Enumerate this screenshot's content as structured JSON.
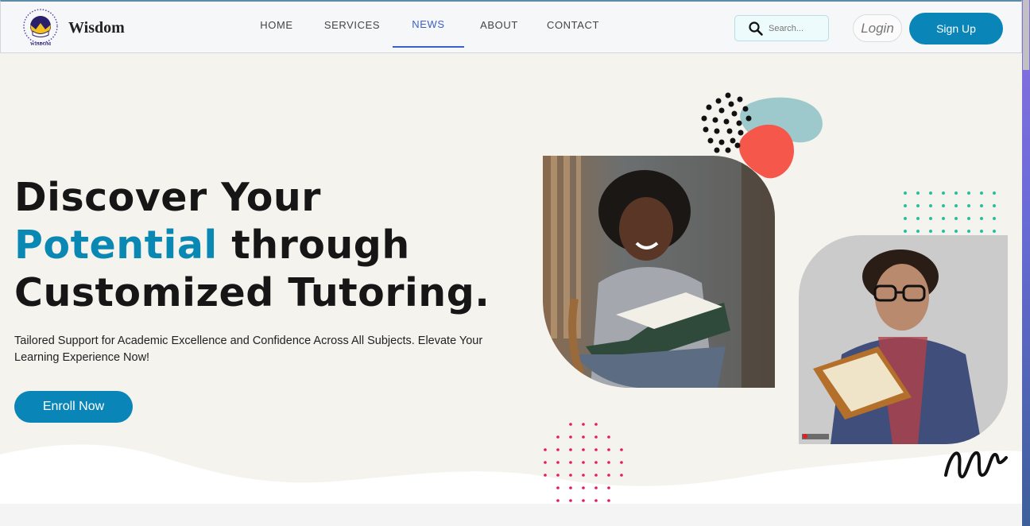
{
  "brand": {
    "name": "Wisdom",
    "logo_text": "WISDOM"
  },
  "nav": {
    "items": [
      {
        "label": "HOME",
        "active": false
      },
      {
        "label": "SERVICES",
        "active": false
      },
      {
        "label": "NEWS",
        "active": true
      },
      {
        "label": "ABOUT",
        "active": false
      },
      {
        "label": "CONTACT",
        "active": false
      }
    ]
  },
  "search": {
    "placeholder": "Search...",
    "icon": "search-icon"
  },
  "auth": {
    "login_label": "Login",
    "signup_label": "Sign Up"
  },
  "hero": {
    "headline_line1": "Discover Your",
    "headline_accent": "Potential",
    "headline_line2_rest": "through",
    "headline_line3": "Customized Tutoring.",
    "subtext": "Tailored Support for Academic Excellence and Confidence Across All Subjects. Elevate Your Learning Experience Now!",
    "cta_label": "Enroll Now"
  },
  "colors": {
    "accent": "#0a85b8",
    "nav_active": "#3a5fcf",
    "hero_bg": "#f5f3ee",
    "blob_teal": "#9ec9cc",
    "blob_coral": "#f5574a",
    "dots_teal": "#1fc1a6",
    "dots_pink": "#e6195f"
  }
}
